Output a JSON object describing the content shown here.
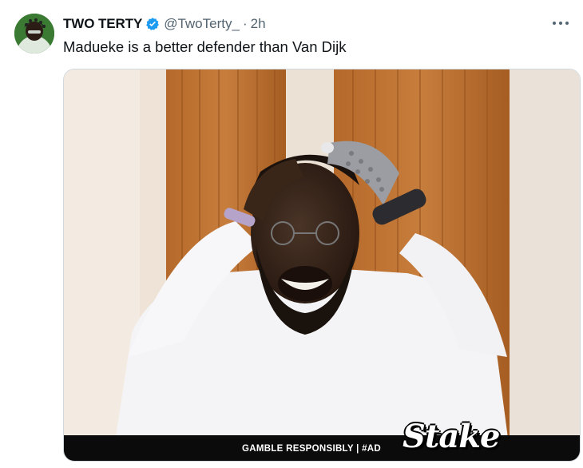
{
  "tweet": {
    "display_name": "TWO TERTY",
    "handle": "@TwoTerty_",
    "separator": "·",
    "time": "2h",
    "text": "Madueke is a better defender than Van Dijk"
  },
  "media": {
    "ad_text": "GAMBLE RESPONSIBLY  |  #AD",
    "logo_text": "Stake"
  },
  "icons": {
    "verified": "verified-badge-icon",
    "more": "more-options-icon"
  },
  "colors": {
    "verified": "#1d9bf0",
    "secondary_text": "#536471",
    "primary_text": "#0f1419"
  }
}
